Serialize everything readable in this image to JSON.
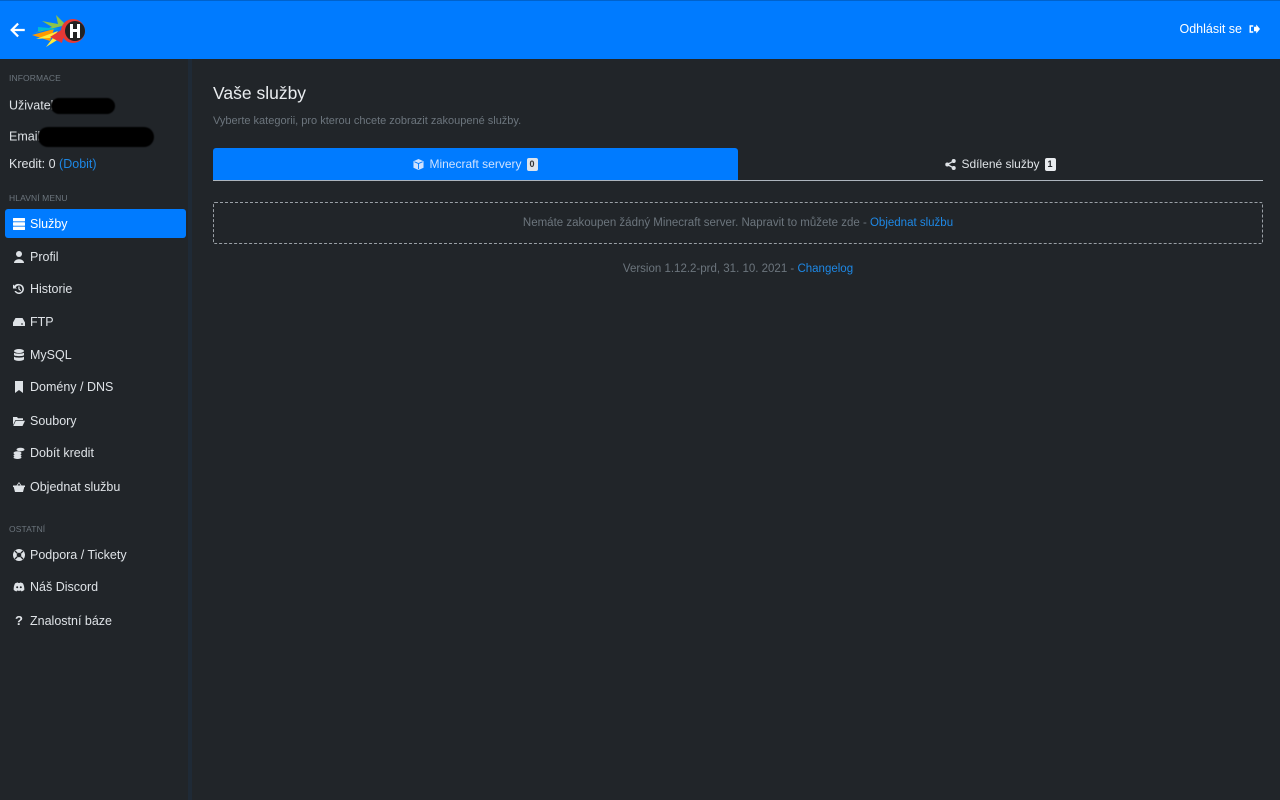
{
  "header": {
    "back_icon": "arrow-left-icon",
    "logo": "flaming-H-logo",
    "logout_label": "Odhlásit se",
    "logout_icon": "sign-out-icon",
    "accent": "#007bff"
  },
  "sidebar": {
    "info_heading": "INFORMACE",
    "user_label": "Uživatel",
    "email_label": "Email",
    "credit_label": "Kredit: 0",
    "credit_link": "(Dobit)",
    "main_menu_heading": "HLAVNÍ MENU",
    "main_items": [
      {
        "label": "Služby",
        "icon": "server-icon",
        "active": true
      },
      {
        "label": "Profil",
        "icon": "user-icon"
      },
      {
        "label": "Historie",
        "icon": "history-icon"
      },
      {
        "label": "FTP",
        "icon": "hdd-icon"
      },
      {
        "label": "MySQL",
        "icon": "database-icon"
      },
      {
        "label": "Domény / DNS",
        "icon": "bookmark-icon"
      },
      {
        "label": "Soubory",
        "icon": "folder-open-icon"
      },
      {
        "label": "Dobít kredit",
        "icon": "coins-icon"
      },
      {
        "label": "Objednat službu",
        "icon": "basket-icon"
      }
    ],
    "other_heading": "OSTATNÍ",
    "other_items": [
      {
        "label": "Podpora / Tickety",
        "icon": "life-ring-icon"
      },
      {
        "label": "Náš Discord",
        "icon": "discord-icon"
      },
      {
        "label": "Znalostní báze",
        "icon": "question-icon"
      }
    ]
  },
  "main": {
    "title": "Vaše služby",
    "subtitle": "Vyberte kategorii, pro kterou chcete zobrazit zakoupené služby.",
    "tabs": [
      {
        "label": "Minecraft servery",
        "count": "0",
        "icon": "cube-icon",
        "active": true
      },
      {
        "label": "Sdílené služby",
        "count": "1",
        "icon": "share-icon"
      }
    ],
    "empty_text": "Nemáte zakoupen žádný Minecraft server. Napravit to můžete zde -",
    "empty_link": "Objednat službu",
    "version_text": "Version 1.12.2-prd, 31. 10. 2021 -",
    "changelog_link": "Changelog"
  }
}
